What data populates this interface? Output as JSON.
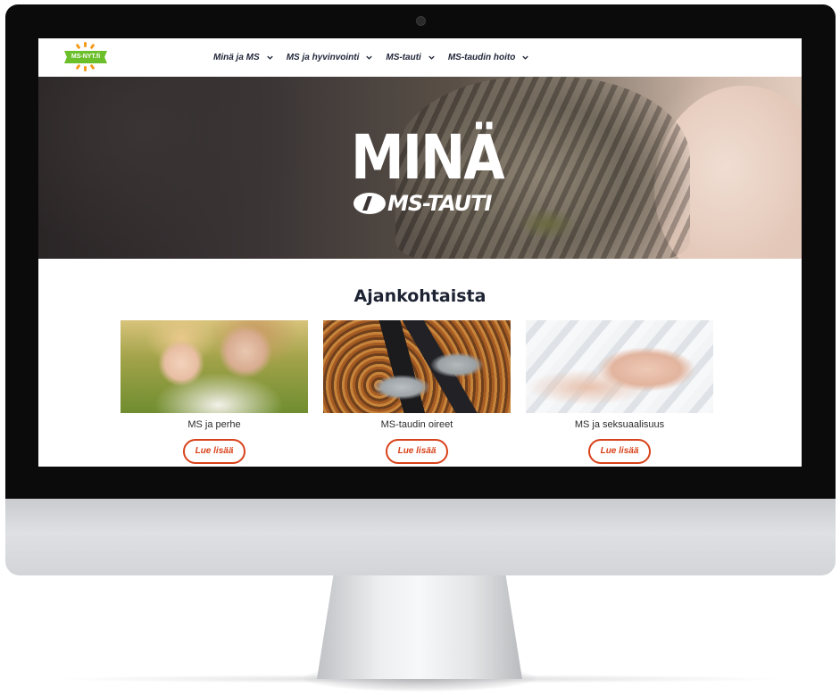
{
  "logo": {
    "text": "MS-NYT.fi"
  },
  "nav": {
    "items": [
      {
        "label": "Minä ja MS"
      },
      {
        "label": "MS ja hyvinvointi"
      },
      {
        "label": "MS-tauti"
      },
      {
        "label": "MS-taudin hoito"
      }
    ]
  },
  "hero": {
    "title": "MINÄ",
    "subtitle": "MS-TAUTI"
  },
  "news": {
    "title": "Ajankohtaista",
    "cards": [
      {
        "label": "MS ja perhe",
        "button": "Lue lisää"
      },
      {
        "label": "MS-taudin oireet",
        "button": "Lue lisää"
      },
      {
        "label": "MS ja seksuaalisuus",
        "button": "Lue lisää"
      }
    ]
  },
  "colors": {
    "accent": "#d8421a",
    "logo_green": "#6bbf2a",
    "logo_orange": "#f39a1b",
    "heading": "#1d2333"
  }
}
